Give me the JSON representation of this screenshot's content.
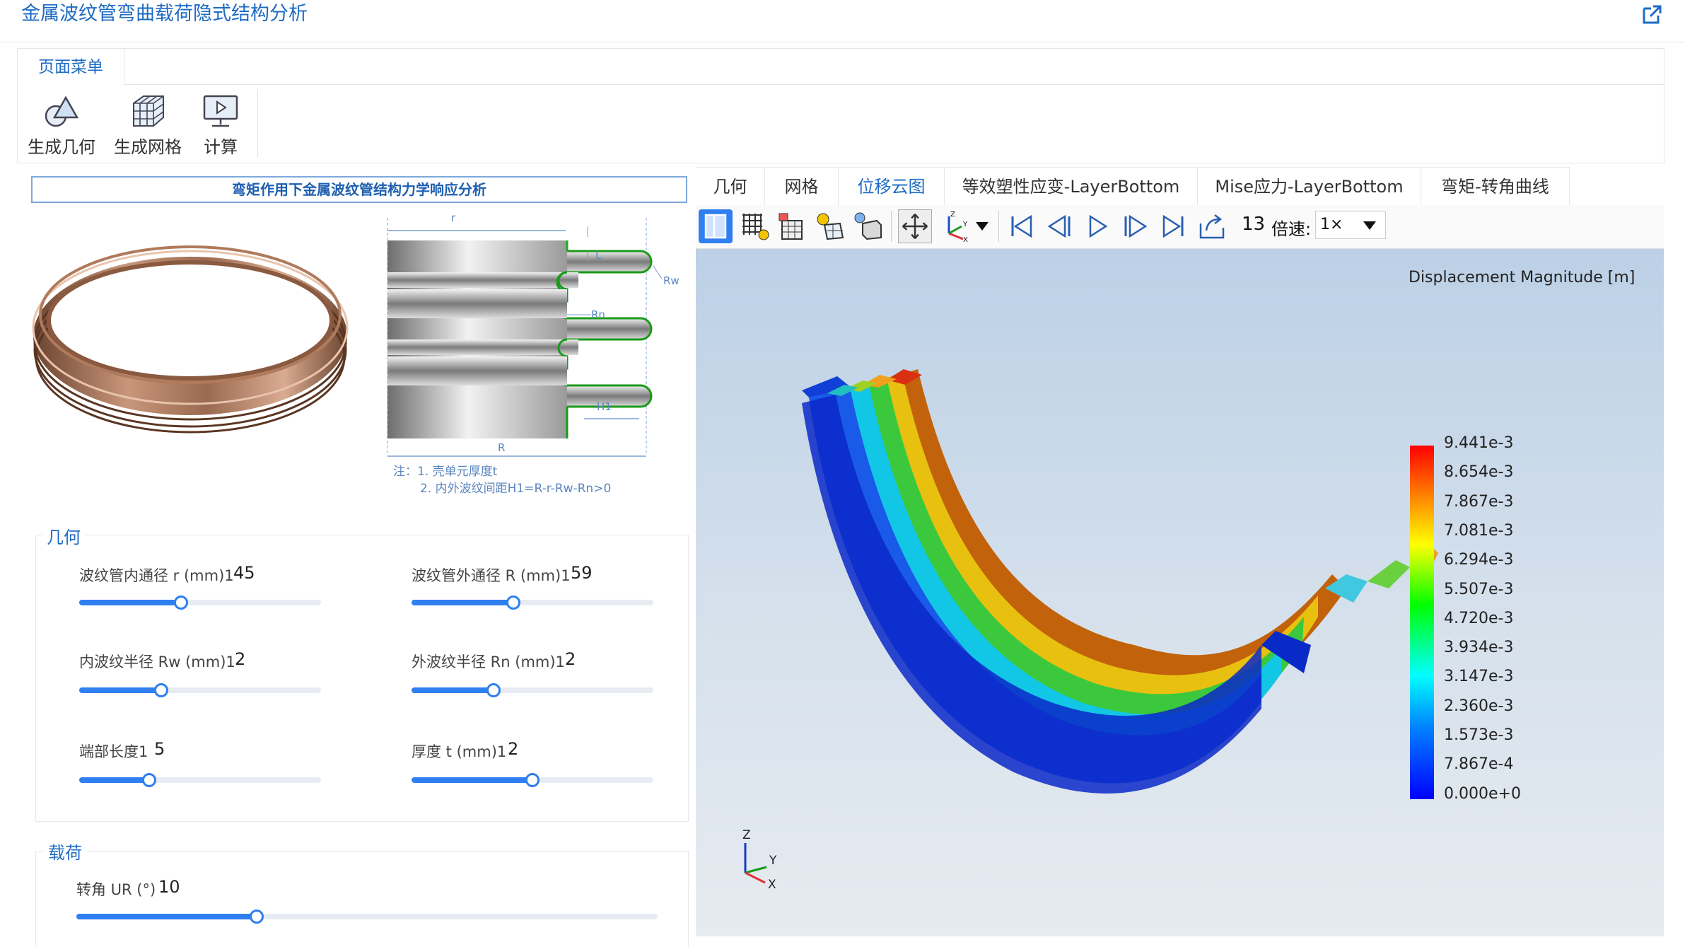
{
  "app": {
    "title": "金属波纹管弯曲载荷隐式结构分析"
  },
  "menu": {
    "tab_label": "页面菜单",
    "tools": [
      {
        "label": "生成几何",
        "icon": "geometry-icon"
      },
      {
        "label": "生成网格",
        "icon": "mesh-icon"
      },
      {
        "label": "计算",
        "icon": "compute-icon"
      }
    ]
  },
  "left": {
    "header": "弯矩作用下金属波纹管结构力学响应分析",
    "diagram": {
      "label_r": "r",
      "label_L": "L",
      "label_Rw": "Rw",
      "label_Rn": "Rn",
      "label_H1": "H1",
      "label_R": "R",
      "note_line1": "注：1.  壳单元厚度t",
      "note_line2": "2.  内外波纹间距H1=R-r-Rw-Rn>0"
    },
    "geometry": {
      "title": "几何",
      "params": [
        {
          "label": "波纹管内通径 r (mm)1",
          "value": "45",
          "fraction": 0.42
        },
        {
          "label": "波纹管外通径 R (mm)1",
          "value": "59",
          "fraction": 0.42
        },
        {
          "label": "内波纹半径 Rw (mm)1",
          "value": "2",
          "fraction": 0.34
        },
        {
          "label": "外波纹半径 Rn (mm)1",
          "value": "2",
          "fraction": 0.34
        },
        {
          "label": "端部长度1",
          "value": "5",
          "fraction": 0.29
        },
        {
          "label": "厚度 t (mm)1",
          "value": "2",
          "fraction": 0.5
        }
      ]
    },
    "load": {
      "title": "载荷",
      "params": [
        {
          "label": "转角 UR (°)",
          "value": "10",
          "fraction": 0.31
        }
      ]
    }
  },
  "tabs": [
    {
      "label": "几何",
      "active": false
    },
    {
      "label": "网格",
      "active": false
    },
    {
      "label": "位移云图",
      "active": true
    },
    {
      "label": "等效塑性应变-LayerBottom",
      "active": false
    },
    {
      "label": "Mise应力-LayerBottom",
      "active": false
    },
    {
      "label": "弯矩-转角曲线",
      "active": false
    }
  ],
  "viewer_toolbar": {
    "frame": "13",
    "speed_label": "倍速:",
    "speed_value": "1×"
  },
  "legend": {
    "title": "Displacement Magnitude [m]",
    "values": [
      "9.441e-3",
      "8.654e-3",
      "7.867e-3",
      "7.081e-3",
      "6.294e-3",
      "5.507e-3",
      "4.720e-3",
      "3.934e-3",
      "3.147e-3",
      "2.360e-3",
      "1.573e-3",
      "7.867e-4",
      "0.000e+0"
    ]
  },
  "axes": {
    "z": "Z",
    "y": "Y",
    "x": "X"
  },
  "colors": {
    "accent": "#1e6bc4",
    "slider": "#2f7ff0"
  }
}
